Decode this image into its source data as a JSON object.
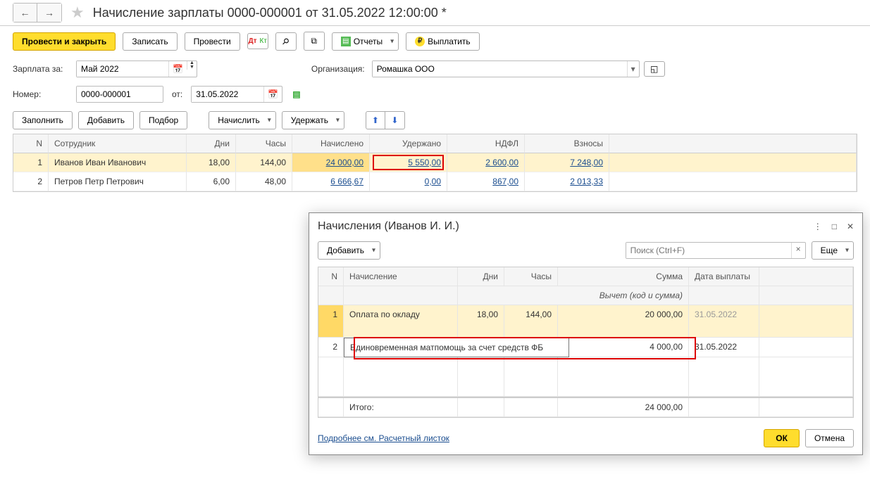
{
  "header": {
    "title": "Начисление зарплаты 0000-000001 от 31.05.2022 12:00:00 *"
  },
  "toolbar": {
    "post_close": "Провести и закрыть",
    "save": "Записать",
    "post": "Провести",
    "reports": "Отчеты",
    "pay": "Выплатить"
  },
  "form": {
    "salary_for_label": "Зарплата за:",
    "salary_for": "Май 2022",
    "org_label": "Организация:",
    "org": "Ромашка ООО",
    "number_label": "Номер:",
    "number": "0000-000001",
    "from_label": "от:",
    "from": "31.05.2022"
  },
  "table_toolbar": {
    "fill": "Заполнить",
    "add": "Добавить",
    "select": "Подбор",
    "calc": "Начислить",
    "hold": "Удержать"
  },
  "main_table": {
    "headers": {
      "n": "N",
      "employee": "Сотрудник",
      "days": "Дни",
      "hours": "Часы",
      "calculated": "Начислено",
      "held": "Удержано",
      "ndfl": "НДФЛ",
      "contributions": "Взносы"
    },
    "rows": [
      {
        "n": "1",
        "employee": "Иванов Иван Иванович",
        "days": "18,00",
        "hours": "144,00",
        "calculated": "24 000,00",
        "held": "5 550,00",
        "ndfl": "2 600,00",
        "contributions": "7 248,00"
      },
      {
        "n": "2",
        "employee": "Петров Петр Петрович",
        "days": "6,00",
        "hours": "48,00",
        "calculated": "6 666,67",
        "held": "0,00",
        "ndfl": "867,00",
        "contributions": "2 013,33"
      }
    ]
  },
  "popup": {
    "title": "Начисления (Иванов И. И.)",
    "add": "Добавить",
    "search_placeholder": "Поиск (Ctrl+F)",
    "more": "Еще",
    "headers": {
      "n": "N",
      "name": "Начисление",
      "days": "Дни",
      "hours": "Часы",
      "sum": "Сумма",
      "date": "Дата выплаты",
      "sub": "Вычет (код и сумма)"
    },
    "rows": [
      {
        "n": "1",
        "name": "Оплата по окладу",
        "days": "18,00",
        "hours": "144,00",
        "sum": "20 000,00",
        "date": "31.05.2022"
      },
      {
        "n": "2",
        "name": "Единовременная матпомощь за счет средств ФБ",
        "days": "",
        "hours": "",
        "sum": "4 000,00",
        "date": "31.05.2022"
      }
    ],
    "total_label": "Итого:",
    "total_sum": "24 000,00",
    "link": "Подробнее см. Расчетный листок",
    "ok": "ОК",
    "cancel": "Отмена"
  }
}
